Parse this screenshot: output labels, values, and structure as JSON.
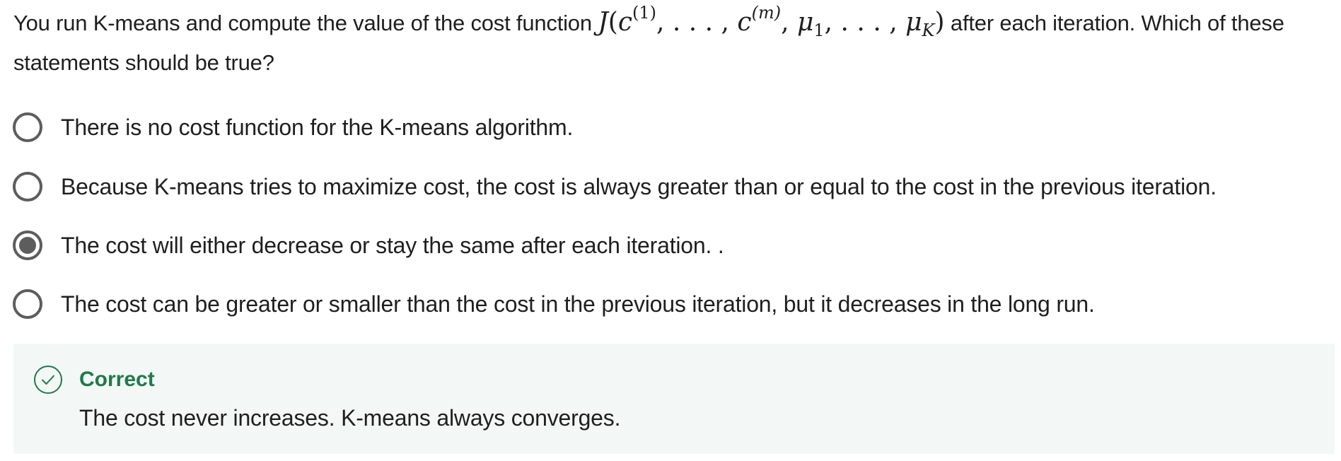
{
  "question": {
    "text_before": "You run K-means and compute the value of the cost function",
    "formula": {
      "J": "J",
      "open": "(",
      "c1_base": "c",
      "c1_sup": "(1)",
      "sep1": ", . . . , ",
      "cm_base": "c",
      "cm_sup": "(m)",
      "sep2": ", ",
      "mu1_base": "μ",
      "mu1_sub": "1",
      "sep3": ", . . . , ",
      "muK_base": "μ",
      "muK_sub": "K",
      "close": ")"
    },
    "text_after": "after each iteration. Which of these statements should be true?"
  },
  "options": [
    {
      "label": "There is no cost function for the K-means algorithm.",
      "selected": false
    },
    {
      "label": "Because K-means tries to maximize cost, the cost is always greater than or equal to the cost in the previous iteration.",
      "selected": false
    },
    {
      "label": "The cost will either decrease or stay the same after each iteration. .",
      "selected": true
    },
    {
      "label": "The cost can be greater or smaller than the cost in the previous iteration, but it decreases in the long run.",
      "selected": false
    }
  ],
  "feedback": {
    "status": "Correct",
    "message": "The cost never increases. K-means always converges.",
    "status_color": "#1f7a4a",
    "background": "#f3f8f6",
    "icon": "check-circle-icon"
  },
  "colors": {
    "radio_border": "#5d5d5d",
    "text": "#1f1f1f"
  }
}
